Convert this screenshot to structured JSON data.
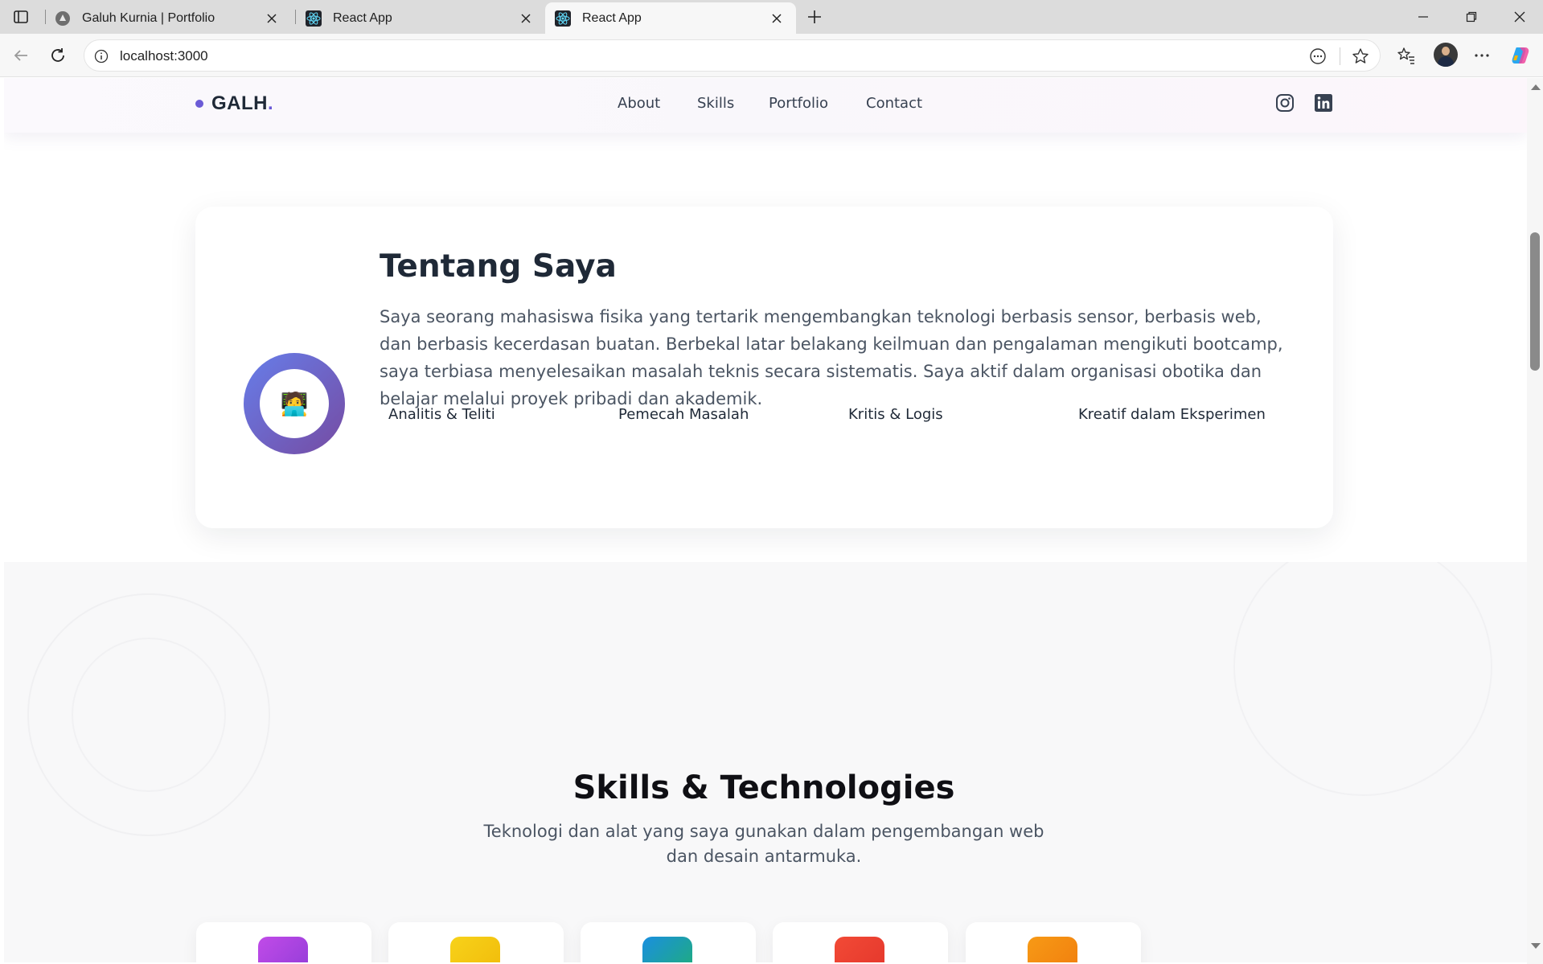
{
  "browser": {
    "tabs": [
      {
        "title": "Galuh Kurnia | Portfolio",
        "icon": "portfolio-favicon"
      },
      {
        "title": "React App",
        "icon": "react-favicon"
      },
      {
        "title": "React App",
        "icon": "react-favicon",
        "active": true
      }
    ],
    "url": "localhost:3000"
  },
  "site": {
    "logo": "GALH",
    "logo_suffix": ".",
    "nav": [
      "About",
      "Skills",
      "Portfolio",
      "Contact"
    ],
    "social": [
      "instagram-icon",
      "linkedin-icon"
    ],
    "accent": "#6b5bd6"
  },
  "about": {
    "title": "Tentang Saya",
    "avatar_emoji": "🧑‍💻",
    "text": "Saya seorang mahasiswa fisika yang tertarik mengembangkan teknologi berbasis sensor, berbasis web, dan berbasis kecerdasan buatan. Berbekal latar belakang keilmuan dan pengalaman mengikuti bootcamp, saya terbiasa menyelesaikan masalah teknis secara sistematis. Saya aktif dalam organisasi obotika dan belajar melalui proyek pribadi dan akademik.",
    "traits": [
      "Analitis & Teliti",
      "Pemecah Masalah",
      "Kritis & Logis",
      "Kreatif dalam Eksperimen"
    ],
    "gradient": [
      "#667eea",
      "#764ba2"
    ]
  },
  "skills": {
    "title": "Skills & Technologies",
    "subtitle": "Teknologi dan alat yang saya gunakan dalam pengembangan web dan desain antarmuka.",
    "card_colors": [
      "#b044e0",
      "#f2c011",
      "#1aa07a",
      "#ee3b2e",
      "#f58b12"
    ]
  }
}
